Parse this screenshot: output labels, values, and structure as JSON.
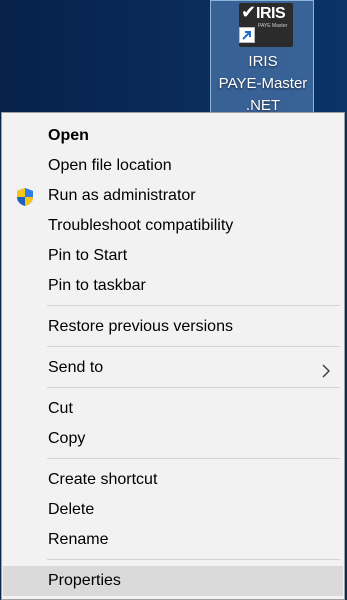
{
  "desktop": {
    "shortcut": {
      "icon": "iris-paye-master-app-icon",
      "icon_brand": "IRIS",
      "icon_subtext": "PAYE Master",
      "label_lines": [
        "IRIS",
        "PAYE-Master",
        ".NET"
      ]
    }
  },
  "context_menu": {
    "items": [
      {
        "label": "Open",
        "bold": true
      },
      {
        "label": "Open file location"
      },
      {
        "label": "Run as administrator",
        "icon": "uac-shield-icon"
      },
      {
        "label": "Troubleshoot compatibility"
      },
      {
        "label": "Pin to Start"
      },
      {
        "label": "Pin to taskbar"
      },
      {
        "label": "Restore previous versions"
      },
      {
        "label": "Send to",
        "submenu_icon": "chevron-right-icon"
      },
      {
        "label": "Cut"
      },
      {
        "label": "Copy"
      },
      {
        "label": "Create shortcut"
      },
      {
        "label": "Delete"
      },
      {
        "label": "Rename"
      },
      {
        "label": "Properties",
        "highlighted": true
      }
    ]
  }
}
